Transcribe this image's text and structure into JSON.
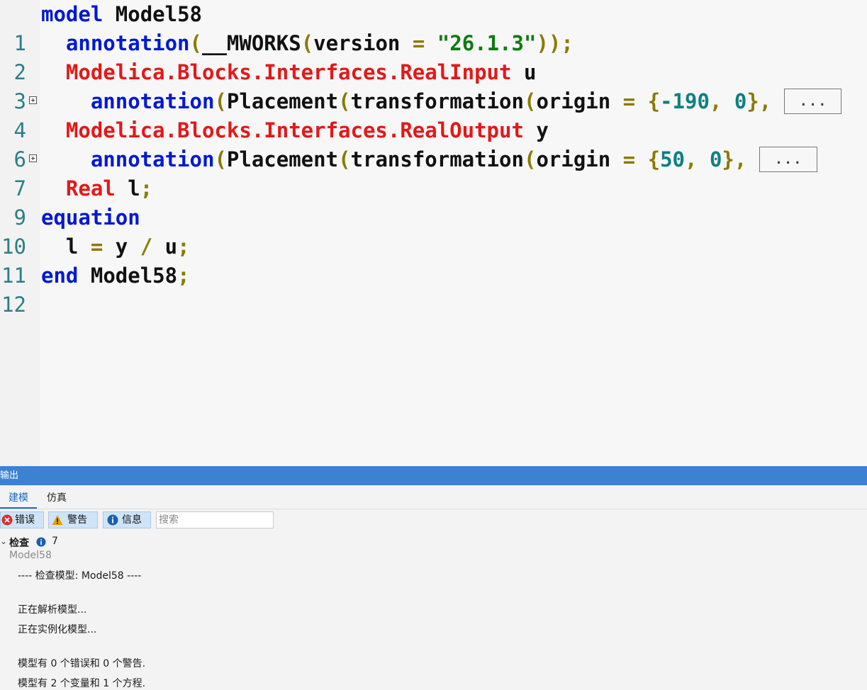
{
  "editor": {
    "lines": [
      {
        "num": "1"
      },
      {
        "num": "2"
      },
      {
        "num": "3"
      },
      {
        "num": "4"
      },
      {
        "num": "6"
      },
      {
        "num": "7"
      },
      {
        "num": "9"
      },
      {
        "num": "10"
      },
      {
        "num": "11"
      },
      {
        "num": "12"
      }
    ],
    "tokens": {
      "l1_kw": "model",
      "l1_name": "Model58",
      "l2_ann": "annotation",
      "l2_paren1": "(",
      "l2_mworks": "__MWORKS",
      "l2_paren2": "(",
      "l2_version": "version",
      "l2_eq": "=",
      "l2_str": "\"26.1.3\"",
      "l2_close": "));",
      "l3_cls": "Modelica.Blocks.Interfaces.RealInput",
      "l3_var": "u",
      "l4_ann": "annotation",
      "l4_p1": "(",
      "l4_place": "Placement",
      "l4_p2": "(",
      "l4_trans": "transformation",
      "l4_p3": "(",
      "l4_origin": "origin",
      "l4_eq": "=",
      "l4_brace_open": "{",
      "l4_n1": "-190",
      "l4_comma1": ",",
      "l4_n2": "0",
      "l4_brace_close": "}",
      "l4_comma2": ",",
      "l4_fold": "...",
      "l6_cls": "Modelica.Blocks.Interfaces.RealOutput",
      "l6_var": "y",
      "l7_ann": "annotation",
      "l7_p1": "(",
      "l7_place": "Placement",
      "l7_p2": "(",
      "l7_trans": "transformation",
      "l7_p3": "(",
      "l7_origin": "origin",
      "l7_eq": "=",
      "l7_brace_open": "{",
      "l7_n1": "50",
      "l7_comma1": ",",
      "l7_n2": "0",
      "l7_brace_close": "}",
      "l7_comma2": ",",
      "l7_fold": "...",
      "l9_type": "Real",
      "l9_var": "l",
      "l9_semi": ";",
      "l10_kw": "equation",
      "l11_l": "l",
      "l11_eq": "=",
      "l11_y": "y",
      "l11_div": "/",
      "l11_u": "u",
      "l11_semi": ";",
      "l12_kw": "end",
      "l12_name": "Model58",
      "l12_semi": ";"
    }
  },
  "output": {
    "title": "输出",
    "tabs": [
      "建模",
      "仿真"
    ],
    "active_tab": "建模",
    "filters": {
      "error": "错误",
      "warning": "警告",
      "info": "信息"
    },
    "search_placeholder": "搜索",
    "group": {
      "label": "检查",
      "count": "7",
      "model": "Model58"
    },
    "messages": [
      "---- 检查模型: Model58 ----",
      "正在解析模型...",
      "正在实例化模型...",
      "模型有 0 个错误和 0 个警告.",
      "模型有 2 个变量和 1 个方程."
    ]
  },
  "colors": {
    "keyword": "#0018d4",
    "class": "#e41818",
    "number": "#0f8080",
    "string": "#0f7a0f",
    "operator": "#8a7a00",
    "line_number": "#2b7f86",
    "panel_header": "#3b82d1"
  }
}
